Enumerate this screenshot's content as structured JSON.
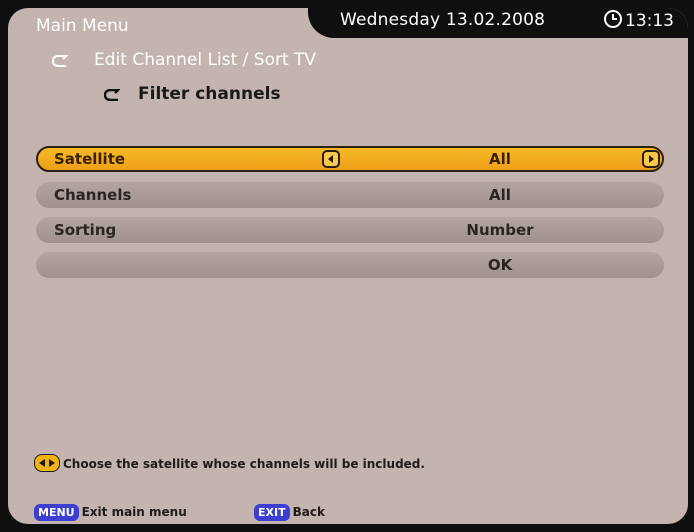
{
  "header": {
    "main_menu": "Main Menu",
    "breadcrumb_1": "Edit Channel List / Sort TV",
    "breadcrumb_2": "Filter channels",
    "date": "Wednesday 13.02.2008",
    "time": "13:13"
  },
  "menu": {
    "items": [
      {
        "label": "Satellite",
        "value": "All",
        "selected": true
      },
      {
        "label": "Channels",
        "value": "All"
      },
      {
        "label": "Sorting",
        "value": "Number"
      },
      {
        "label": "",
        "value": "OK"
      }
    ]
  },
  "hint": "Choose the satellite whose channels will be included.",
  "footer": {
    "menu_key": "MENU",
    "menu_label": "Exit main menu",
    "exit_key": "EXIT",
    "exit_label": "Back"
  },
  "colors": {
    "panel": "#c4b4b0",
    "selected": "#eea017",
    "row": "#a89a97",
    "key_blue": "#3c3fd0"
  }
}
